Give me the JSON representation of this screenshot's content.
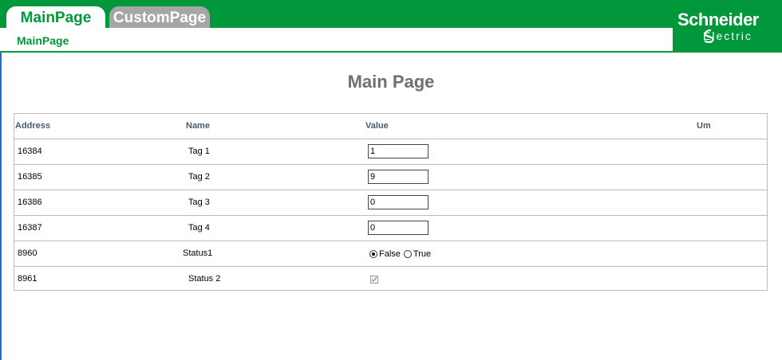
{
  "tabs": [
    {
      "label": "MainPage",
      "active": true
    },
    {
      "label": "CustomPage",
      "active": false
    }
  ],
  "breadcrumb": "MainPage",
  "logo": {
    "line1": "Schneider",
    "line2": "Electric"
  },
  "page_title": "Main Page",
  "table": {
    "headers": {
      "address": "Address",
      "name": "Name",
      "value": "Value",
      "um": "Um"
    },
    "rows": [
      {
        "address": "16384",
        "name": "Tag 1",
        "value": "1"
      },
      {
        "address": "16385",
        "name": "Tag 2",
        "value": "9"
      },
      {
        "address": "16386",
        "name": "Tag 3",
        "value": "0"
      },
      {
        "address": "16387",
        "name": "Tag 4",
        "value": "0"
      },
      {
        "address": "8960",
        "name": "Status1",
        "radio": {
          "options": [
            "False",
            "True"
          ],
          "selected": "False"
        }
      },
      {
        "address": "8961",
        "name": "Status 2",
        "checkbox": {
          "checked": true,
          "disabled": true
        }
      }
    ]
  },
  "colors": {
    "brand_green": "#00983a",
    "inactive_tab": "#a6a6a6",
    "title_gray": "#6d6f71"
  }
}
